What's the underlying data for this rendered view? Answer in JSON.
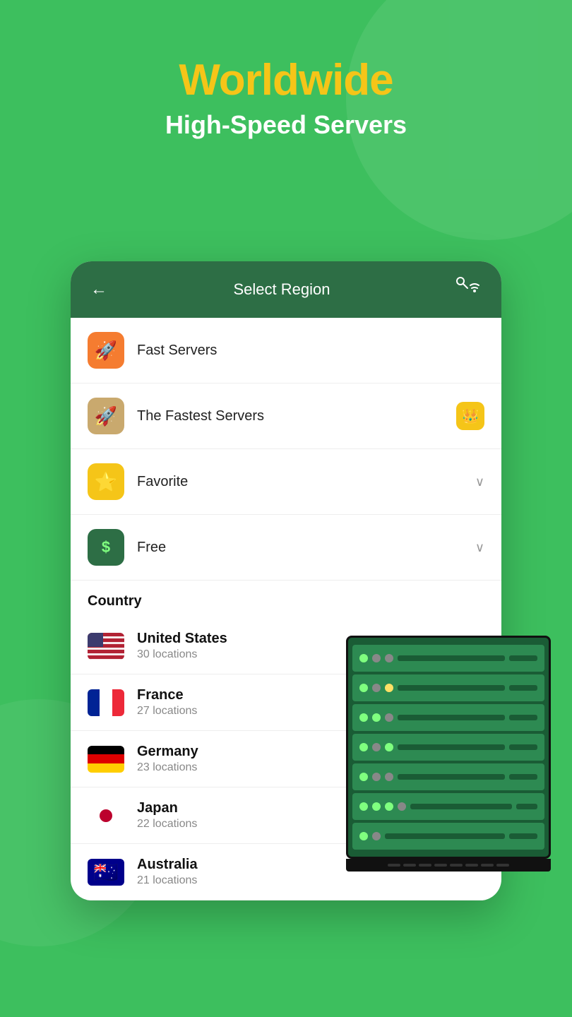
{
  "hero": {
    "title": "Worldwide",
    "subtitle": "High-Speed Servers"
  },
  "header": {
    "back_icon": "←",
    "title": "Select Region",
    "wifi_icon": "wifi-x"
  },
  "menu_items": [
    {
      "id": "fast-servers",
      "icon": "🚀",
      "icon_style": "orange",
      "label": "Fast Servers",
      "right": "none"
    },
    {
      "id": "fastest-servers",
      "icon": "🚀",
      "icon_style": "tan",
      "label": "The Fastest Servers",
      "right": "crown"
    },
    {
      "id": "favorite",
      "icon": "⭐",
      "icon_style": "yellow",
      "label": "Favorite",
      "right": "chevron"
    },
    {
      "id": "free",
      "icon": "$",
      "icon_style": "green",
      "label": "Free",
      "right": "chevron"
    }
  ],
  "country_section_label": "Country",
  "countries": [
    {
      "id": "us",
      "name": "United States",
      "locations": "30 locations",
      "flag": "us"
    },
    {
      "id": "fr",
      "name": "France",
      "locations": "27 locations",
      "flag": "fr"
    },
    {
      "id": "de",
      "name": "Germany",
      "locations": "23 locations",
      "flag": "de"
    },
    {
      "id": "jp",
      "name": "Japan",
      "locations": "22 locations",
      "flag": "jp"
    },
    {
      "id": "au",
      "name": "Australia",
      "locations": "21 locations",
      "flag": "au"
    }
  ]
}
